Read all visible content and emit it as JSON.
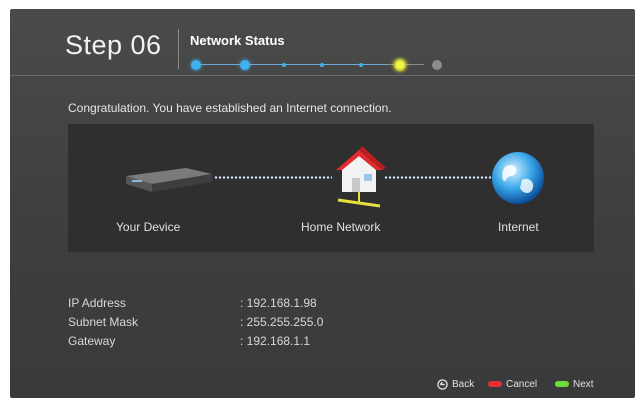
{
  "header": {
    "step_label": "Step 06",
    "title": "Network Status",
    "progress": {
      "current_step": 6,
      "total_steps": 7
    }
  },
  "message": "Congratulation. You have established an Internet connection.",
  "diagram": {
    "device_label": "Your Device",
    "network_label": "Home Network",
    "internet_label": "Internet",
    "icons": [
      "set-top-box-icon",
      "home-network-icon",
      "globe-icon"
    ]
  },
  "info": [
    {
      "key": "IP Address",
      "value": ": 192.168.1.98"
    },
    {
      "key": "Subnet Mask",
      "value": ": 255.255.255.0"
    },
    {
      "key": "Gateway",
      "value": ": 192.168.1.1"
    }
  ],
  "footer": {
    "back_label": "Back",
    "cancel_label": "Cancel",
    "next_label": "Next",
    "colors": {
      "cancel": "#e0303a",
      "next": "#6edc3a"
    }
  },
  "colors": {
    "accent": "#3fb0ec",
    "current": "#f1f44b"
  }
}
